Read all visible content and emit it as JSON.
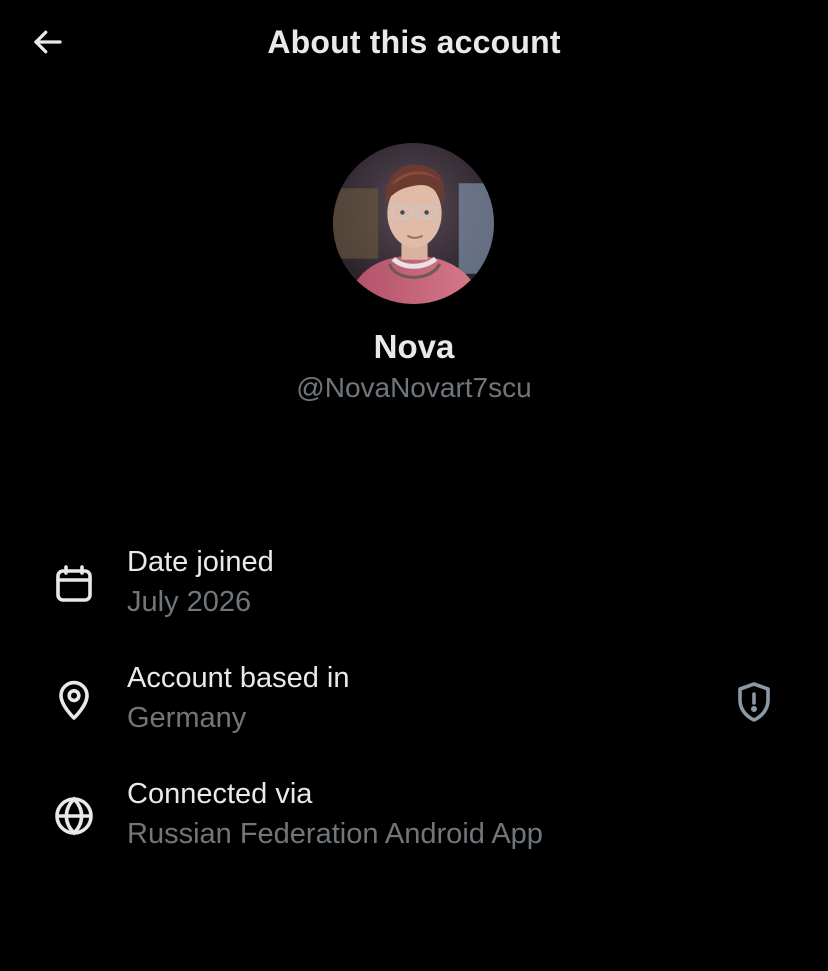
{
  "header": {
    "title": "About this account",
    "back_icon": "arrow-left-icon"
  },
  "profile": {
    "display_name": "Nova",
    "handle": "@NovaNovart7scu",
    "avatar_icon": "profile-avatar"
  },
  "info": [
    {
      "icon": "calendar-icon",
      "label": "Date joined",
      "value": "July 2026"
    },
    {
      "icon": "location-pin-icon",
      "label": "Account based in",
      "value": "Germany",
      "action_icon": "shield-alert-icon"
    },
    {
      "icon": "globe-icon",
      "label": "Connected via",
      "value": "Russian Federation Android App"
    }
  ],
  "colors": {
    "background": "#000000",
    "primary_text": "#e7e9ea",
    "secondary_text": "#71767b"
  }
}
